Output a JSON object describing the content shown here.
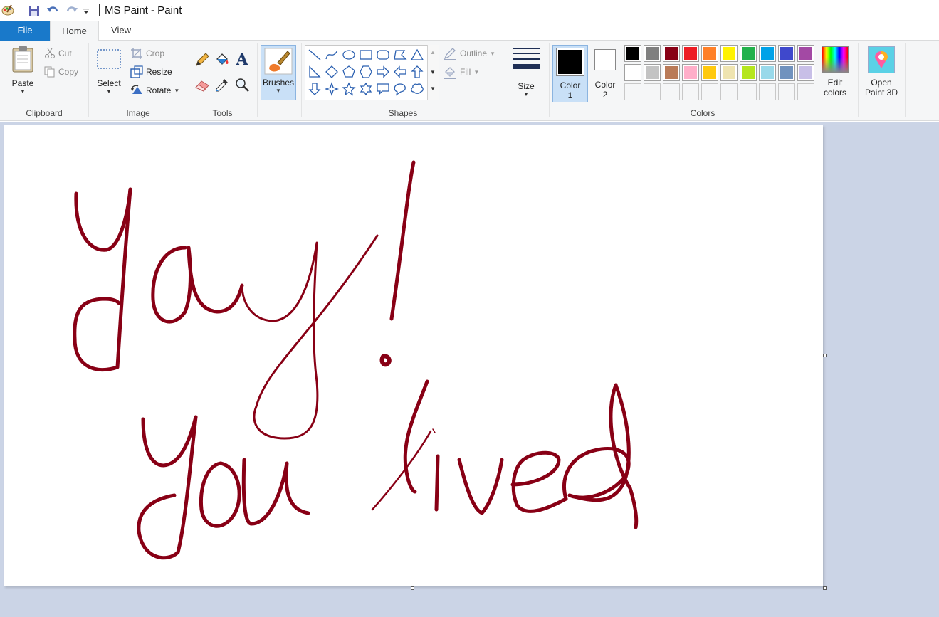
{
  "window": {
    "title": "MS Paint - Paint"
  },
  "tabs": {
    "file": "File",
    "home": "Home",
    "view": "View"
  },
  "clipboard": {
    "paste": "Paste",
    "cut": "Cut",
    "copy": "Copy",
    "label": "Clipboard"
  },
  "image": {
    "select": "Select",
    "crop": "Crop",
    "resize": "Resize",
    "rotate": "Rotate",
    "label": "Image"
  },
  "tools": {
    "label": "Tools"
  },
  "brushes": {
    "label": "Brushes"
  },
  "shapes": {
    "outline": "Outline",
    "fill": "Fill",
    "label": "Shapes"
  },
  "size": {
    "label": "Size"
  },
  "colors": {
    "color1_line1": "Color",
    "color1_line2": "1",
    "color2_line1": "Color",
    "color2_line2": "2",
    "label": "Colors",
    "edit_line1": "Edit",
    "edit_line2": "colors",
    "color1": "#000000",
    "color2": "#ffffff",
    "palette_row1": [
      "#000000",
      "#7f7f7f",
      "#880015",
      "#ed1c24",
      "#ff7f27",
      "#fff200",
      "#22b14c",
      "#00a2e8",
      "#3f48cc",
      "#a349a4"
    ],
    "palette_row2": [
      "#ffffff",
      "#c3c3c3",
      "#b97a57",
      "#ffaec9",
      "#ffc90e",
      "#efe4b0",
      "#b5e61d",
      "#99d9ea",
      "#7092be",
      "#c8bfe7"
    ]
  },
  "paint3d": {
    "line1": "Open",
    "line2": "Paint 3D"
  },
  "drawing": {
    "ink_color": "#880015"
  }
}
